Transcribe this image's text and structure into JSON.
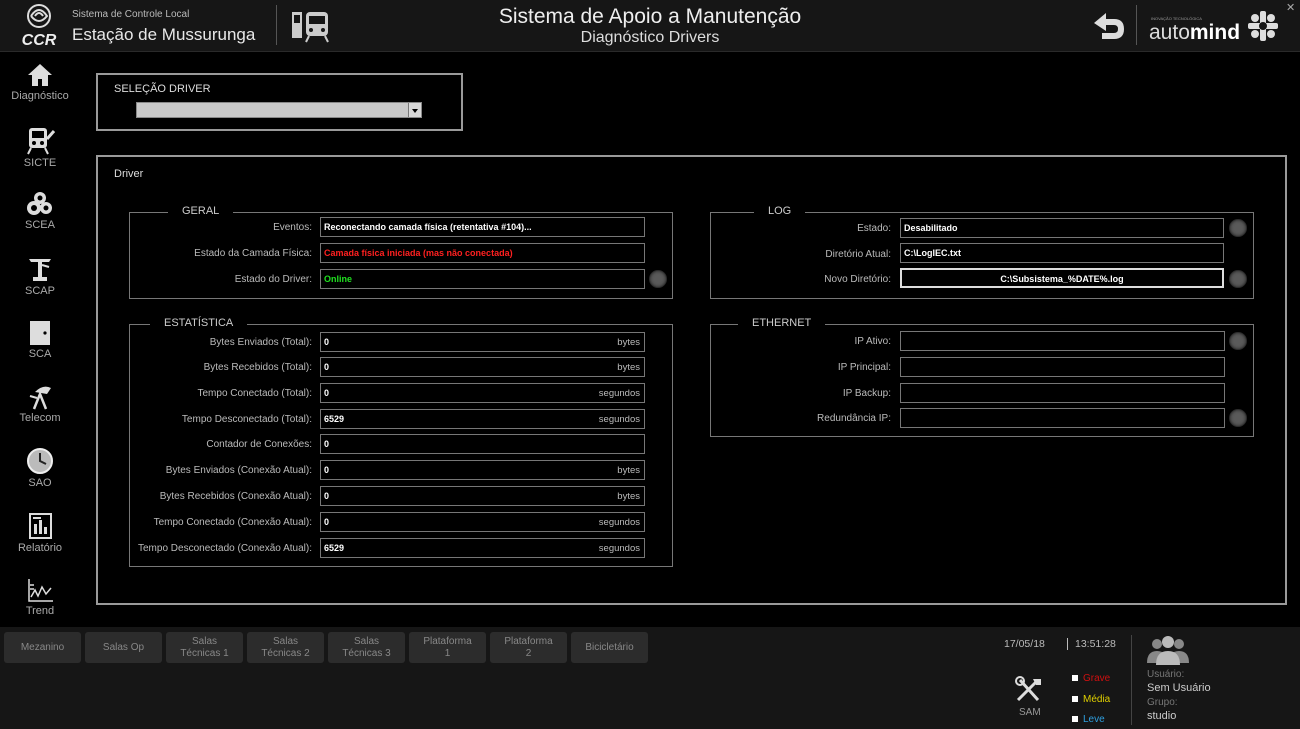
{
  "header": {
    "company_logo": "CCR",
    "system_subtitle": "Sistema de Controle Local",
    "station_name": "Estação de Mussurunga",
    "title": "Sistema de Apoio a Manutenção",
    "subtitle": "Diagnóstico Drivers",
    "brand_tagline": "INOVAÇÃO TECNOLÓGICA",
    "brand_prefix": "auto",
    "brand_suffix": "mind",
    "close_symbol": "✕"
  },
  "sidebar": {
    "items": [
      {
        "label": "Diagnóstico",
        "icon": "home-icon"
      },
      {
        "label": "SICTE",
        "icon": "train-icon"
      },
      {
        "label": "SCEA",
        "icon": "gears-icon"
      },
      {
        "label": "SCAP",
        "icon": "fire-hydrant-icon"
      },
      {
        "label": "SCA",
        "icon": "door-icon"
      },
      {
        "label": "Telecom",
        "icon": "antenna-icon"
      },
      {
        "label": "SAO",
        "icon": "clock-icon"
      },
      {
        "label": "Relatório",
        "icon": "report-icon"
      },
      {
        "label": "Trend",
        "icon": "trend-icon"
      }
    ]
  },
  "driver_select": {
    "label": "SELEÇÃO DRIVER",
    "value": ""
  },
  "driver_panel": {
    "title": "Driver",
    "geral": {
      "title": "GERAL",
      "eventos_label": "Eventos:",
      "eventos_value": "Reconectando camada física (retentativa #104)...",
      "camada_label": "Estado da Camada Física:",
      "camada_value": "Camada física iniciada (mas não conectada)",
      "driver_label": "Estado do Driver:",
      "driver_value": "Online"
    },
    "estatistica": {
      "title": "ESTATÍSTICA",
      "rows": [
        {
          "label": "Bytes Enviados (Total):",
          "value": "0",
          "unit": "bytes"
        },
        {
          "label": "Bytes Recebidos (Total):",
          "value": "0",
          "unit": "bytes"
        },
        {
          "label": "Tempo Conectado (Total):",
          "value": "0",
          "unit": "segundos"
        },
        {
          "label": "Tempo Desconectado (Total):",
          "value": "6529",
          "unit": "segundos"
        },
        {
          "label": "Contador de Conexões:",
          "value": "0",
          "unit": ""
        },
        {
          "label": "Bytes Enviados (Conexão Atual):",
          "value": "0",
          "unit": "bytes"
        },
        {
          "label": "Bytes Recebidos (Conexão Atual):",
          "value": "0",
          "unit": "bytes"
        },
        {
          "label": "Tempo Conectado (Conexão Atual):",
          "value": "0",
          "unit": "segundos"
        },
        {
          "label": "Tempo Desconectado (Conexão Atual):",
          "value": "6529",
          "unit": "segundos"
        }
      ]
    },
    "log": {
      "title": "LOG",
      "estado_label": "Estado:",
      "estado_value": "Desabilitado",
      "diretorio_label": "Diretório Atual:",
      "diretorio_value": "C:\\LogIEC.txt",
      "novo_label": "Novo Diretório:",
      "novo_value": "C:\\Subsistema_%DATE%.log"
    },
    "ethernet": {
      "title": "ETHERNET",
      "ip_ativo_label": "IP Ativo:",
      "ip_ativo_value": "",
      "ip_principal_label": "IP Principal:",
      "ip_principal_value": "",
      "ip_backup_label": "IP Backup:",
      "ip_backup_value": "",
      "redundancia_label": "Redundância IP:",
      "redundancia_value": ""
    }
  },
  "bottom_nav": {
    "buttons": [
      {
        "line1": "Mezanino",
        "line2": ""
      },
      {
        "line1": "Salas Op",
        "line2": ""
      },
      {
        "line1": "Salas",
        "line2": "Técnicas 1"
      },
      {
        "line1": "Salas",
        "line2": "Técnicas 2"
      },
      {
        "line1": "Salas",
        "line2": "Técnicas 3"
      },
      {
        "line1": "Plataforma",
        "line2": "1"
      },
      {
        "line1": "Plataforma",
        "line2": "2"
      },
      {
        "line1": "Bicicletário",
        "line2": ""
      }
    ]
  },
  "status": {
    "date": "17/05/18",
    "time": "13:51:28",
    "sam_label": "SAM",
    "severities": [
      {
        "label": "Grave",
        "color": "#d01010"
      },
      {
        "label": "Média",
        "color": "#e0d000"
      },
      {
        "label": "Leve",
        "color": "#2fa0e0"
      }
    ],
    "user_label": "Usuário:",
    "user_value": "Sem Usuário",
    "group_label": "Grupo:",
    "group_value": "studio"
  },
  "colors": {
    "error_text": "#ff2020",
    "ok_text": "#20e020",
    "brand_bold": "#ffffff"
  }
}
